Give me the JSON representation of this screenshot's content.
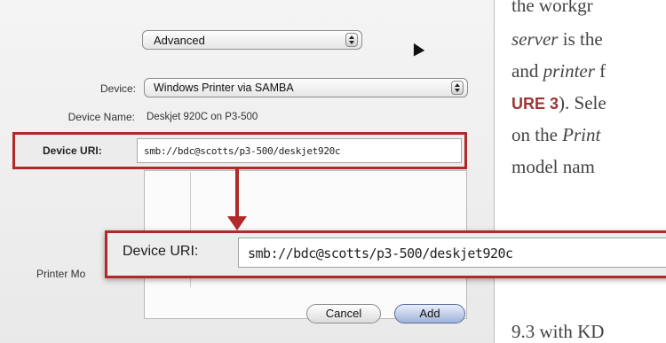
{
  "dialog": {
    "mode_popup": "Advanced",
    "device_label": "Device:",
    "device_value": "Windows Printer via SAMBA",
    "device_name_label": "Device Name:",
    "device_name_value": "Deskjet 920C on P3-500",
    "device_uri_label": "Device URI:",
    "device_uri_value": "smb://bdc@scotts/p3-500/deskjet920c",
    "printer_model_label": "Printer Mo",
    "cancel_button": "Cancel",
    "add_button": "Add"
  },
  "callout": {
    "label": "Device URI:",
    "value": "smb://bdc@scotts/p3-500/deskjet920c"
  },
  "book_text": {
    "line1": "the workgr",
    "line2_em": "server",
    "line2_rest": " is the",
    "line3_pre": "and ",
    "line3_em": "printer",
    "line3_rest": " f",
    "line4_caps": "URE 3",
    "line4_rest": "). Sele",
    "line5_pre": "on the ",
    "line5_em": "Print",
    "line6": "model nam",
    "line7": "9.3 with KD"
  }
}
